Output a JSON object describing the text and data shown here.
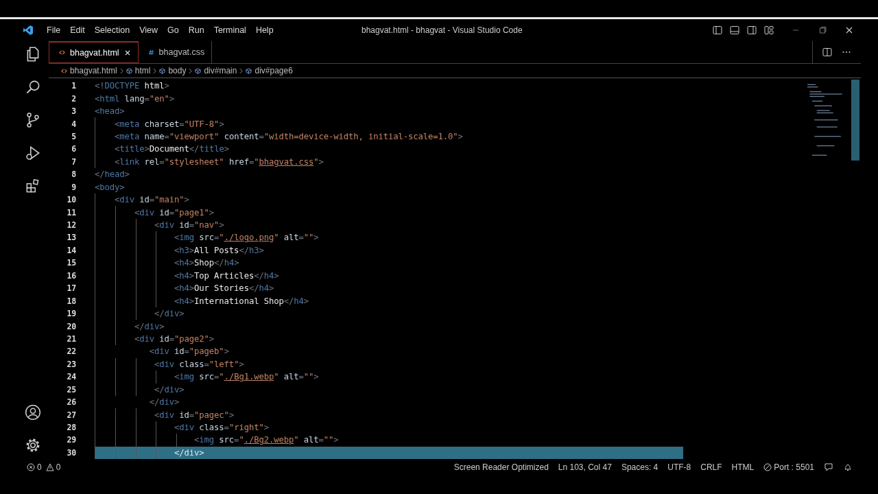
{
  "window": {
    "title": "bhagvat.html - bhagvat - Visual Studio Code"
  },
  "menu": [
    "File",
    "Edit",
    "Selection",
    "View",
    "Go",
    "Run",
    "Terminal",
    "Help"
  ],
  "tabs": [
    {
      "label": "bhagvat.html",
      "kind": "html",
      "selected": true
    },
    {
      "label": "bhagvat.css",
      "kind": "css",
      "selected": false
    }
  ],
  "breadcrumbs": [
    {
      "label": "bhagvat.html",
      "kind": "file"
    },
    {
      "label": "html",
      "kind": "element"
    },
    {
      "label": "body",
      "kind": "element"
    },
    {
      "label": "div#main",
      "kind": "element"
    },
    {
      "label": "div#page6",
      "kind": "element"
    }
  ],
  "code_lines": [
    {
      "number": "1",
      "highlighted": false,
      "tokens": [
        {
          "kind": "punct",
          "text": "<!"
        },
        {
          "kind": "tag",
          "text": "DOCTYPE"
        },
        {
          "kind": "text",
          "text": " html"
        },
        {
          "kind": "punct",
          "text": ">"
        }
      ]
    },
    {
      "number": "2",
      "highlighted": false,
      "tokens": [
        {
          "kind": "punct",
          "text": "<"
        },
        {
          "kind": "tag",
          "text": "html"
        },
        {
          "kind": "attr",
          "text": " lang"
        },
        {
          "kind": "punct",
          "text": "="
        },
        {
          "kind": "string",
          "text": "\"en\""
        },
        {
          "kind": "punct",
          "text": ">"
        }
      ]
    },
    {
      "number": "3",
      "highlighted": false,
      "tokens": [
        {
          "kind": "punct",
          "text": "<"
        },
        {
          "kind": "tag",
          "text": "head"
        },
        {
          "kind": "punct",
          "text": ">"
        }
      ]
    },
    {
      "number": "4",
      "highlighted": false,
      "tokens": [
        {
          "kind": "punct",
          "text": "    <"
        },
        {
          "kind": "tag",
          "text": "meta"
        },
        {
          "kind": "attr",
          "text": " charset"
        },
        {
          "kind": "punct",
          "text": "="
        },
        {
          "kind": "string",
          "text": "\"UTF-8\""
        },
        {
          "kind": "punct",
          "text": ">"
        }
      ]
    },
    {
      "number": "5",
      "highlighted": false,
      "tokens": [
        {
          "kind": "punct",
          "text": "    <"
        },
        {
          "kind": "tag",
          "text": "meta"
        },
        {
          "kind": "attr",
          "text": " name"
        },
        {
          "kind": "punct",
          "text": "="
        },
        {
          "kind": "string",
          "text": "\"viewport\""
        },
        {
          "kind": "attr",
          "text": " content"
        },
        {
          "kind": "punct",
          "text": "="
        },
        {
          "kind": "string",
          "text": "\"width=device-width, initial-scale=1.0\""
        },
        {
          "kind": "punct",
          "text": ">"
        }
      ]
    },
    {
      "number": "6",
      "highlighted": false,
      "tokens": [
        {
          "kind": "punct",
          "text": "    <"
        },
        {
          "kind": "tag",
          "text": "title"
        },
        {
          "kind": "punct",
          "text": ">"
        },
        {
          "kind": "text",
          "text": "Document"
        },
        {
          "kind": "punct",
          "text": "</"
        },
        {
          "kind": "tag",
          "text": "title"
        },
        {
          "kind": "punct",
          "text": ">"
        }
      ]
    },
    {
      "number": "7",
      "highlighted": false,
      "tokens": [
        {
          "kind": "punct",
          "text": "    <"
        },
        {
          "kind": "tag",
          "text": "link"
        },
        {
          "kind": "attr",
          "text": " rel"
        },
        {
          "kind": "punct",
          "text": "="
        },
        {
          "kind": "string",
          "text": "\"stylesheet\""
        },
        {
          "kind": "attr",
          "text": " href"
        },
        {
          "kind": "punct",
          "text": "="
        },
        {
          "kind": "string",
          "text": "\""
        },
        {
          "kind": "link",
          "text": "bhagvat.css"
        },
        {
          "kind": "string",
          "text": "\""
        },
        {
          "kind": "punct",
          "text": ">"
        }
      ]
    },
    {
      "number": "8",
      "highlighted": false,
      "tokens": [
        {
          "kind": "punct",
          "text": "</"
        },
        {
          "kind": "tag",
          "text": "head"
        },
        {
          "kind": "punct",
          "text": ">"
        }
      ]
    },
    {
      "number": "9",
      "highlighted": false,
      "tokens": [
        {
          "kind": "punct",
          "text": "<"
        },
        {
          "kind": "tag",
          "text": "body"
        },
        {
          "kind": "punct",
          "text": ">"
        }
      ]
    },
    {
      "number": "10",
      "highlighted": false,
      "tokens": [
        {
          "kind": "punct",
          "text": "    <"
        },
        {
          "kind": "tag",
          "text": "div"
        },
        {
          "kind": "attr",
          "text": " id"
        },
        {
          "kind": "punct",
          "text": "="
        },
        {
          "kind": "string",
          "text": "\"main\""
        },
        {
          "kind": "punct",
          "text": ">"
        }
      ]
    },
    {
      "number": "11",
      "highlighted": false,
      "tokens": [
        {
          "kind": "punct",
          "text": "        <"
        },
        {
          "kind": "tag",
          "text": "div"
        },
        {
          "kind": "attr",
          "text": " id"
        },
        {
          "kind": "punct",
          "text": "="
        },
        {
          "kind": "string",
          "text": "\"page1\""
        },
        {
          "kind": "punct",
          "text": ">"
        }
      ]
    },
    {
      "number": "12",
      "highlighted": false,
      "tokens": [
        {
          "kind": "punct",
          "text": "            <"
        },
        {
          "kind": "tag",
          "text": "div"
        },
        {
          "kind": "attr",
          "text": " id"
        },
        {
          "kind": "punct",
          "text": "="
        },
        {
          "kind": "string",
          "text": "\"nav\""
        },
        {
          "kind": "punct",
          "text": ">"
        }
      ]
    },
    {
      "number": "13",
      "highlighted": false,
      "tokens": [
        {
          "kind": "punct",
          "text": "                <"
        },
        {
          "kind": "tag",
          "text": "img"
        },
        {
          "kind": "attr",
          "text": " src"
        },
        {
          "kind": "punct",
          "text": "="
        },
        {
          "kind": "string",
          "text": "\""
        },
        {
          "kind": "link",
          "text": "./logo.png"
        },
        {
          "kind": "string",
          "text": "\""
        },
        {
          "kind": "attr",
          "text": " alt"
        },
        {
          "kind": "punct",
          "text": "="
        },
        {
          "kind": "string",
          "text": "\"\""
        },
        {
          "kind": "punct",
          "text": ">"
        }
      ]
    },
    {
      "number": "14",
      "highlighted": false,
      "tokens": [
        {
          "kind": "punct",
          "text": "                <"
        },
        {
          "kind": "tag",
          "text": "h3"
        },
        {
          "kind": "punct",
          "text": ">"
        },
        {
          "kind": "text",
          "text": "All Posts"
        },
        {
          "kind": "punct",
          "text": "</"
        },
        {
          "kind": "tag",
          "text": "h3"
        },
        {
          "kind": "punct",
          "text": ">"
        }
      ]
    },
    {
      "number": "15",
      "highlighted": false,
      "tokens": [
        {
          "kind": "punct",
          "text": "                <"
        },
        {
          "kind": "tag",
          "text": "h4"
        },
        {
          "kind": "punct",
          "text": ">"
        },
        {
          "kind": "text",
          "text": "Shop"
        },
        {
          "kind": "punct",
          "text": "</"
        },
        {
          "kind": "tag",
          "text": "h4"
        },
        {
          "kind": "punct",
          "text": ">"
        }
      ]
    },
    {
      "number": "16",
      "highlighted": false,
      "tokens": [
        {
          "kind": "punct",
          "text": "                <"
        },
        {
          "kind": "tag",
          "text": "h4"
        },
        {
          "kind": "punct",
          "text": ">"
        },
        {
          "kind": "text",
          "text": "Top Articles"
        },
        {
          "kind": "punct",
          "text": "</"
        },
        {
          "kind": "tag",
          "text": "h4"
        },
        {
          "kind": "punct",
          "text": ">"
        }
      ]
    },
    {
      "number": "17",
      "highlighted": false,
      "tokens": [
        {
          "kind": "punct",
          "text": "                <"
        },
        {
          "kind": "tag",
          "text": "h4"
        },
        {
          "kind": "punct",
          "text": ">"
        },
        {
          "kind": "text",
          "text": "Our Stories"
        },
        {
          "kind": "punct",
          "text": "</"
        },
        {
          "kind": "tag",
          "text": "h4"
        },
        {
          "kind": "punct",
          "text": ">"
        }
      ]
    },
    {
      "number": "18",
      "highlighted": false,
      "tokens": [
        {
          "kind": "punct",
          "text": "                <"
        },
        {
          "kind": "tag",
          "text": "h4"
        },
        {
          "kind": "punct",
          "text": ">"
        },
        {
          "kind": "text",
          "text": "International Shop"
        },
        {
          "kind": "punct",
          "text": "</"
        },
        {
          "kind": "tag",
          "text": "h4"
        },
        {
          "kind": "punct",
          "text": ">"
        }
      ]
    },
    {
      "number": "19",
      "highlighted": false,
      "tokens": [
        {
          "kind": "punct",
          "text": "            </"
        },
        {
          "kind": "tag",
          "text": "div"
        },
        {
          "kind": "punct",
          "text": ">"
        }
      ]
    },
    {
      "number": "20",
      "highlighted": false,
      "tokens": [
        {
          "kind": "punct",
          "text": "        </"
        },
        {
          "kind": "tag",
          "text": "div"
        },
        {
          "kind": "punct",
          "text": ">"
        }
      ]
    },
    {
      "number": "21",
      "highlighted": false,
      "tokens": [
        {
          "kind": "punct",
          "text": "        <"
        },
        {
          "kind": "tag",
          "text": "div"
        },
        {
          "kind": "attr",
          "text": " id"
        },
        {
          "kind": "punct",
          "text": "="
        },
        {
          "kind": "string",
          "text": "\"page2\""
        },
        {
          "kind": "punct",
          "text": ">"
        }
      ]
    },
    {
      "number": "22",
      "highlighted": false,
      "tokens": [
        {
          "kind": "punct",
          "text": "           <"
        },
        {
          "kind": "tag",
          "text": "div"
        },
        {
          "kind": "attr",
          "text": " id"
        },
        {
          "kind": "punct",
          "text": "="
        },
        {
          "kind": "string",
          "text": "\"pageb\""
        },
        {
          "kind": "punct",
          "text": ">"
        }
      ]
    },
    {
      "number": "23",
      "highlighted": false,
      "tokens": [
        {
          "kind": "punct",
          "text": "            <"
        },
        {
          "kind": "tag",
          "text": "div"
        },
        {
          "kind": "attr",
          "text": " class"
        },
        {
          "kind": "punct",
          "text": "="
        },
        {
          "kind": "string",
          "text": "\"left\""
        },
        {
          "kind": "punct",
          "text": ">"
        }
      ]
    },
    {
      "number": "24",
      "highlighted": false,
      "tokens": [
        {
          "kind": "punct",
          "text": "                <"
        },
        {
          "kind": "tag",
          "text": "img"
        },
        {
          "kind": "attr",
          "text": " src"
        },
        {
          "kind": "punct",
          "text": "="
        },
        {
          "kind": "string",
          "text": "\""
        },
        {
          "kind": "link",
          "text": "./Bg1.webp"
        },
        {
          "kind": "string",
          "text": "\""
        },
        {
          "kind": "attr",
          "text": " alt"
        },
        {
          "kind": "punct",
          "text": "="
        },
        {
          "kind": "string",
          "text": "\"\""
        },
        {
          "kind": "punct",
          "text": ">"
        }
      ]
    },
    {
      "number": "25",
      "highlighted": false,
      "tokens": [
        {
          "kind": "punct",
          "text": "            </"
        },
        {
          "kind": "tag",
          "text": "div"
        },
        {
          "kind": "punct",
          "text": ">"
        }
      ]
    },
    {
      "number": "26",
      "highlighted": false,
      "tokens": [
        {
          "kind": "punct",
          "text": "           </"
        },
        {
          "kind": "tag",
          "text": "div"
        },
        {
          "kind": "punct",
          "text": ">"
        }
      ]
    },
    {
      "number": "27",
      "highlighted": false,
      "tokens": [
        {
          "kind": "punct",
          "text": "            <"
        },
        {
          "kind": "tag",
          "text": "div"
        },
        {
          "kind": "attr",
          "text": " id"
        },
        {
          "kind": "punct",
          "text": "="
        },
        {
          "kind": "string",
          "text": "\"pagec\""
        },
        {
          "kind": "punct",
          "text": ">"
        }
      ]
    },
    {
      "number": "28",
      "highlighted": false,
      "tokens": [
        {
          "kind": "punct",
          "text": "                <"
        },
        {
          "kind": "tag",
          "text": "div"
        },
        {
          "kind": "attr",
          "text": " class"
        },
        {
          "kind": "punct",
          "text": "="
        },
        {
          "kind": "string",
          "text": "\"right\""
        },
        {
          "kind": "punct",
          "text": ">"
        }
      ]
    },
    {
      "number": "29",
      "highlighted": false,
      "tokens": [
        {
          "kind": "punct",
          "text": "                    <"
        },
        {
          "kind": "tag",
          "text": "img"
        },
        {
          "kind": "attr",
          "text": " src"
        },
        {
          "kind": "punct",
          "text": "="
        },
        {
          "kind": "string",
          "text": "\""
        },
        {
          "kind": "link",
          "text": "./Bg2.webp"
        },
        {
          "kind": "string",
          "text": "\""
        },
        {
          "kind": "attr",
          "text": " alt"
        },
        {
          "kind": "punct",
          "text": "="
        },
        {
          "kind": "string",
          "text": "\"\""
        },
        {
          "kind": "punct",
          "text": ">"
        }
      ]
    },
    {
      "number": "30",
      "highlighted": true,
      "tokens": [
        {
          "kind": "punct",
          "text": "                </"
        },
        {
          "kind": "tag",
          "text": "div"
        },
        {
          "kind": "punct",
          "text": ">"
        }
      ]
    }
  ],
  "status_bar": {
    "errors": "0",
    "warnings": "0",
    "items": [
      "Screen Reader Optimized",
      "Ln 103, Col 47",
      "Spaces: 4",
      "UTF-8",
      "CRLF",
      "HTML"
    ],
    "port": "Port : 5501"
  }
}
